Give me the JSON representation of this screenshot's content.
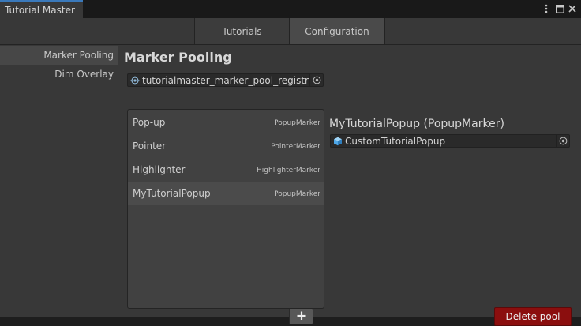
{
  "window": {
    "title": "Tutorial Master",
    "controls": [
      "kebab-menu-icon",
      "maximize-icon",
      "close-icon"
    ]
  },
  "tabs": [
    {
      "label": "Tutorials",
      "active": false
    },
    {
      "label": "Configuration",
      "active": true
    }
  ],
  "sidebar": {
    "items": [
      {
        "label": "Marker Pooling",
        "selected": true
      },
      {
        "label": "Dim Overlay",
        "selected": false
      }
    ]
  },
  "main": {
    "title": "Marker Pooling",
    "registry_field": {
      "value": "tutorialmaster_marker_pool_registry (",
      "icon": "scriptable-object-icon"
    },
    "pool_list": [
      {
        "name": "Pop-up",
        "type": "PopupMarker",
        "selected": false
      },
      {
        "name": "Pointer",
        "type": "PointerMarker",
        "selected": false
      },
      {
        "name": "Highlighter",
        "type": "HighlighterMarker",
        "selected": false
      },
      {
        "name": "MyTutorialPopup",
        "type": "PopupMarker",
        "selected": true
      }
    ],
    "add_button": {
      "icon": "plus-icon"
    },
    "detail": {
      "title": "MyTutorialPopup (PopupMarker)",
      "prefab_field": {
        "value": "CustomTutorialPopup",
        "icon": "prefab-cube-icon"
      }
    },
    "delete_button": {
      "label": "Delete pool"
    }
  },
  "colors": {
    "accent_tab": "#3a79bb",
    "delete_button": "#8b0e0e",
    "panel": "#383838",
    "prefab_icon": "#4fa8e8"
  }
}
